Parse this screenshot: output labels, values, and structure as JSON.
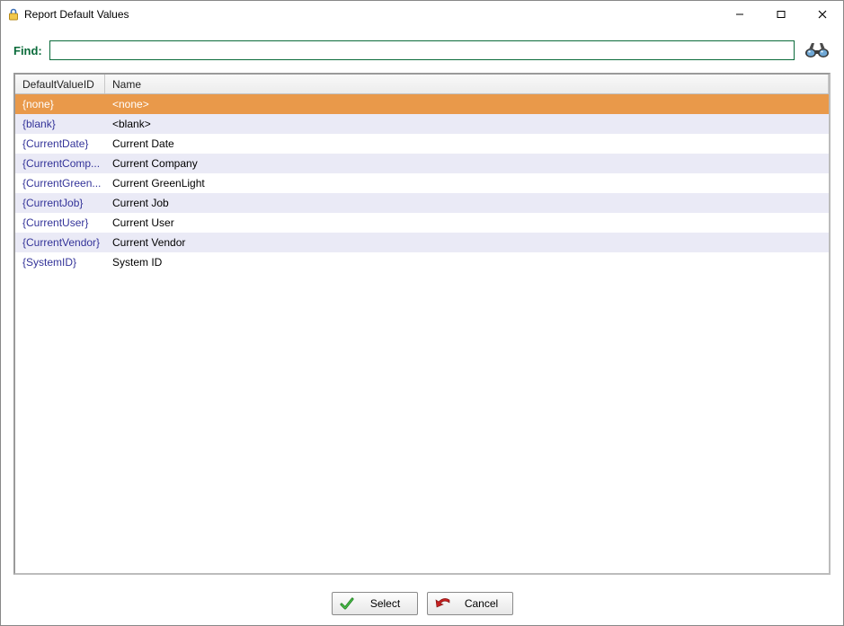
{
  "window": {
    "title": "Report Default Values"
  },
  "find": {
    "label": "Find:",
    "value": ""
  },
  "grid": {
    "headers": {
      "id": "DefaultValueID",
      "name": "Name"
    },
    "rows": [
      {
        "id": "{none}",
        "name": "<none>",
        "selected": true
      },
      {
        "id": "{blank}",
        "name": "<blank>"
      },
      {
        "id": "{CurrentDate}",
        "name": "Current Date"
      },
      {
        "id": "{CurrentComp...",
        "name": "Current Company"
      },
      {
        "id": "{CurrentGreen...",
        "name": "Current GreenLight"
      },
      {
        "id": "{CurrentJob}",
        "name": "Current Job"
      },
      {
        "id": "{CurrentUser}",
        "name": "Current User"
      },
      {
        "id": "{CurrentVendor}",
        "name": "Current Vendor"
      },
      {
        "id": "{SystemID}",
        "name": "System ID"
      }
    ]
  },
  "buttons": {
    "select": "Select",
    "cancel": "Cancel"
  }
}
